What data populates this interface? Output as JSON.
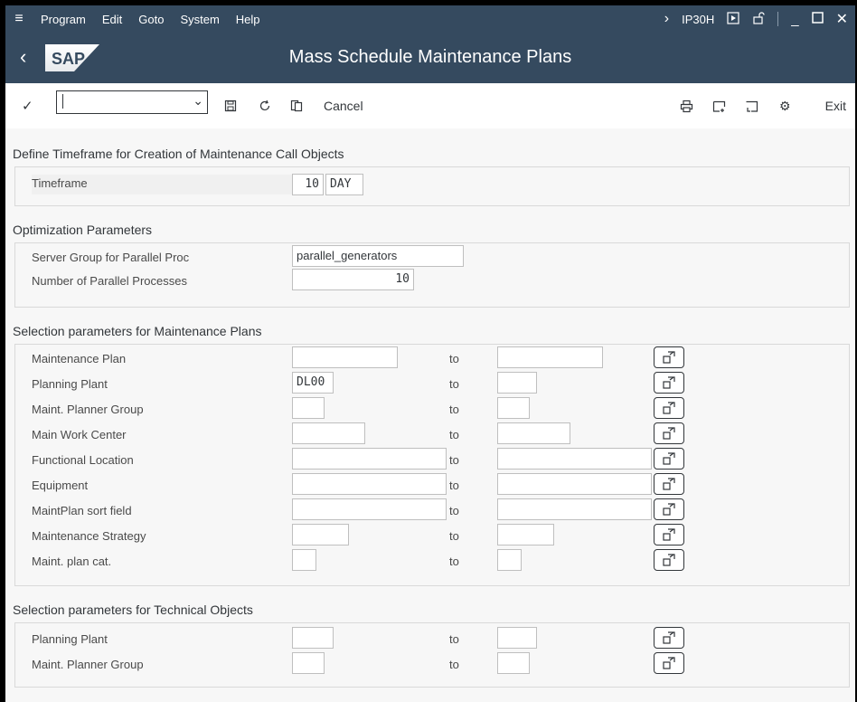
{
  "menubar": {
    "items": [
      "Program",
      "Edit",
      "Goto",
      "System",
      "Help"
    ],
    "tcode": "IP30H"
  },
  "title": "Mass Schedule Maintenance Plans",
  "logo_text": "SAP",
  "toolbar": {
    "command_value": "",
    "cancel_label": "Cancel",
    "exit_label": "Exit"
  },
  "sections": {
    "timeframe": {
      "title": "Define Timeframe for Creation of Maintenance Call Objects",
      "label": "Timeframe",
      "value": "10",
      "unit": "DAY"
    },
    "optimization": {
      "title": "Optimization Parameters",
      "server_group_label": "Server Group for Parallel Proc",
      "server_group_value": "parallel_generators",
      "num_processes_label": "Number of Parallel Processes",
      "num_processes_value": "10"
    },
    "plans": {
      "title": "Selection parameters for Maintenance Plans",
      "to_label": "to",
      "rows": [
        {
          "label": "Maintenance Plan",
          "from": "",
          "to": ""
        },
        {
          "label": "Planning Plant",
          "from": "DL00",
          "to": ""
        },
        {
          "label": "Maint. Planner Group",
          "from": "",
          "to": ""
        },
        {
          "label": "Main Work Center",
          "from": "",
          "to": ""
        },
        {
          "label": "Functional Location",
          "from": "",
          "to": ""
        },
        {
          "label": "Equipment",
          "from": "",
          "to": ""
        },
        {
          "label": "MaintPlan sort field",
          "from": "",
          "to": ""
        },
        {
          "label": "Maintenance Strategy",
          "from": "",
          "to": ""
        },
        {
          "label": "Maint. plan cat.",
          "from": "",
          "to": ""
        }
      ]
    },
    "tech": {
      "title": "Selection parameters for Technical Objects",
      "to_label": "to",
      "rows": [
        {
          "label": "Planning Plant",
          "from": "",
          "to": ""
        },
        {
          "label": "Maint. Planner Group",
          "from": "",
          "to": ""
        }
      ]
    }
  },
  "colors": {
    "shell": "#354a5f",
    "content_bg": "#f7f7f7"
  }
}
